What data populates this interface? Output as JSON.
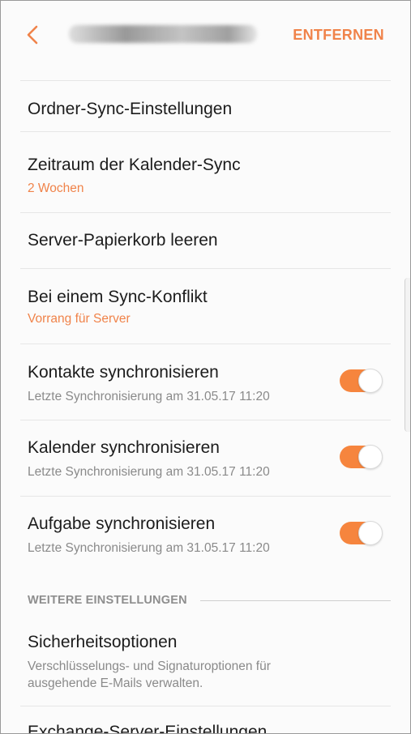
{
  "header": {
    "remove_label": "ENTFERNEN",
    "back_icon": "chevron-left-icon",
    "accent_color": "#f0834a"
  },
  "settings": {
    "folder_sync": {
      "title": "Ordner-Sync-Einstellungen"
    },
    "calendar_period": {
      "title": "Zeitraum der Kalender-Sync",
      "value": "2 Wochen"
    },
    "empty_trash": {
      "title": "Server-Papierkorb leeren"
    },
    "sync_conflict": {
      "title": "Bei einem Sync-Konflikt",
      "value": "Vorrang für Server"
    },
    "contacts": {
      "title": "Kontakte synchronisieren",
      "subtitle": "Letzte Synchronisierung am 31.05.17  11:20",
      "enabled": true
    },
    "calendar": {
      "title": "Kalender synchronisieren",
      "subtitle": "Letzte Synchronisierung am 31.05.17  11:20",
      "enabled": true
    },
    "tasks": {
      "title": "Aufgabe synchronisieren",
      "subtitle": "Letzte Synchronisierung am 31.05.17  11:20",
      "enabled": true
    }
  },
  "more_section": {
    "header": "WEITERE EINSTELLUNGEN",
    "security": {
      "title": "Sicherheitsoptionen",
      "description": "Verschlüsselungs- und Signaturoptionen für ausgehende E-Mails verwalten."
    },
    "exchange": {
      "title": "Exchange-Server-Einstellungen"
    }
  }
}
